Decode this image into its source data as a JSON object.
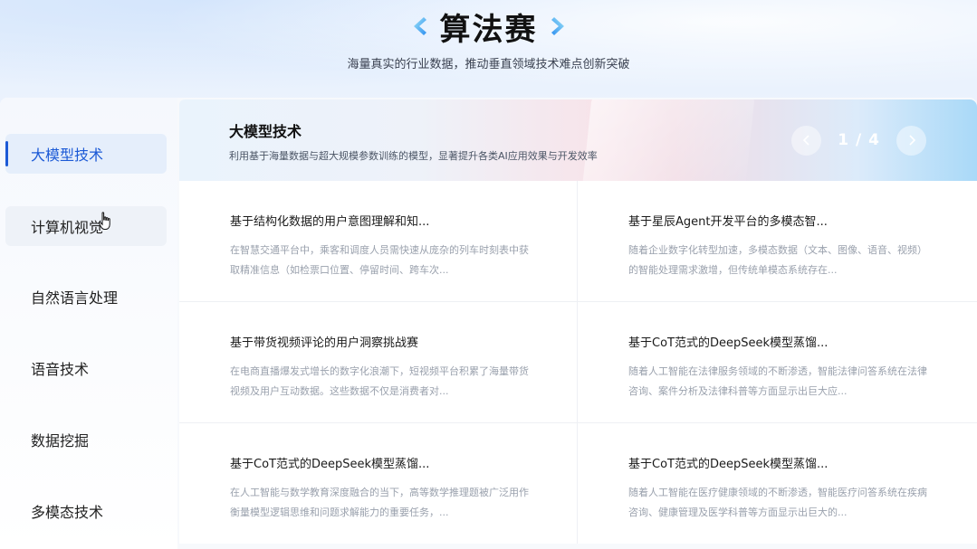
{
  "header": {
    "title": "算法赛",
    "subtitle": "海量真实的行业数据，推动垂直领域技术难点创新突破"
  },
  "sidebar": {
    "items": [
      {
        "label": "大模型技术",
        "active": true
      },
      {
        "label": "计算机视觉",
        "active": false
      },
      {
        "label": "自然语言处理",
        "active": false
      },
      {
        "label": "语音技术",
        "active": false
      },
      {
        "label": "数据挖掘",
        "active": false
      },
      {
        "label": "多模态技术",
        "active": false
      }
    ]
  },
  "banner": {
    "title": "大模型技术",
    "description": "利用基于海量数据与超大规模参数训练的模型，显著提升各类AI应用效果与开发效率",
    "pager": "1 / 4"
  },
  "cards": [
    {
      "title": "基于结构化数据的用户意图理解和知...",
      "desc": "在智慧交通平台中，乘客和调度人员需快速从庞杂的列车时刻表中获取精准信息（如检票口位置、停留时间、跨车次..."
    },
    {
      "title": "基于星辰Agent开发平台的多模态智...",
      "desc": "随着企业数字化转型加速，多模态数据（文本、图像、语音、视频）的智能处理需求激增，但传统单模态系统存在..."
    },
    {
      "title": "基于带货视频评论的用户洞察挑战赛",
      "desc": "在电商直播爆发式增长的数字化浪潮下，短视频平台积累了海量带货视频及用户互动数据。这些数据不仅是消费者对..."
    },
    {
      "title": "基于CoT范式的DeepSeek模型蒸馏...",
      "desc": "随着人工智能在法律服务领域的不断渗透，智能法律问答系统在法律咨询、案件分析及法律科普等方面显示出巨大应..."
    },
    {
      "title": "基于CoT范式的DeepSeek模型蒸馏...",
      "desc": "在人工智能与数学教育深度融合的当下，高等数学推理题被广泛用作衡量模型逻辑思维和问题求解能力的重要任务，..."
    },
    {
      "title": "基于CoT范式的DeepSeek模型蒸馏...",
      "desc": "随着人工智能在医疗健康领域的不断渗透，智能医疗问答系统在疾病咨询、健康管理及医学科普等方面显示出巨大的..."
    }
  ],
  "colors": {
    "accent": "#1c5ad6",
    "chevron_left": "#2fb6f0",
    "chevron_right": "#2fb6f0",
    "active_bg": "#e5eefb"
  },
  "icons": {
    "title_left": "chevron-left-icon",
    "title_right": "chevron-right-icon",
    "pager_prev": "chevron-left-icon",
    "pager_next": "chevron-right-icon",
    "cursor": "hand-pointer-icon"
  }
}
